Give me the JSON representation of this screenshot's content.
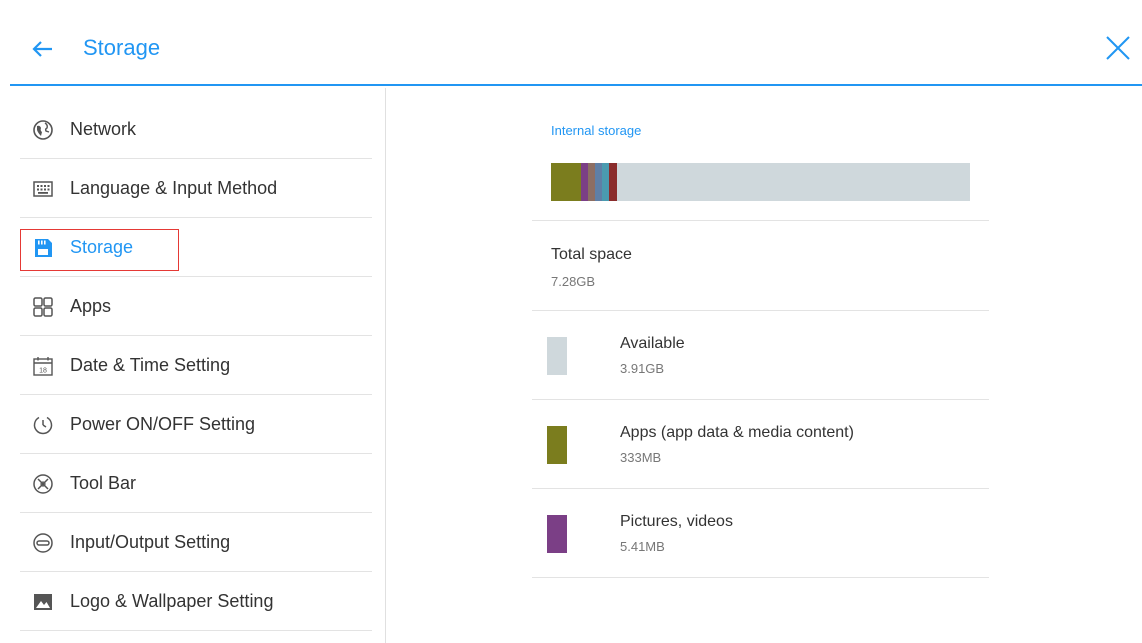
{
  "header": {
    "title": "Storage",
    "back_icon": "arrow-left-icon",
    "close_icon": "close-icon",
    "accent_color": "#2196f3"
  },
  "sidebar": {
    "selected_index": 2,
    "items": [
      {
        "label": "Network",
        "icon": "globe-icon"
      },
      {
        "label": "Language & Input Method",
        "icon": "keyboard-icon"
      },
      {
        "label": "Storage",
        "icon": "storage-icon"
      },
      {
        "label": "Apps",
        "icon": "apps-grid-icon"
      },
      {
        "label": "Date & Time Setting",
        "icon": "calendar-icon",
        "icon_text": "18"
      },
      {
        "label": "Power ON/OFF Setting",
        "icon": "power-timer-icon"
      },
      {
        "label": "Tool Bar",
        "icon": "toolbar-icon"
      },
      {
        "label": "Input/Output Setting",
        "icon": "input-output-icon"
      },
      {
        "label": "Logo & Wallpaper Setting",
        "icon": "image-icon"
      }
    ]
  },
  "main": {
    "section_title": "Internal storage",
    "usage_bar_colors": {
      "available": "#cfd8dc",
      "apps": "#7b7d1e",
      "pictures": "#7b3f86",
      "other_1": "#8d6e63",
      "other_2": "#5f7fa6",
      "other_3": "#4a9bb0",
      "other_4": "#8a2c2c"
    },
    "total": {
      "label": "Total space",
      "value": "7.28GB"
    },
    "rows": [
      {
        "label": "Available",
        "value": "3.91GB",
        "color": "#cfd8dc"
      },
      {
        "label": "Apps (app data & media content)",
        "value": "333MB",
        "color": "#7b7d1e"
      },
      {
        "label": "Pictures, videos",
        "value": "5.41MB",
        "color": "#7b3f86"
      }
    ]
  }
}
